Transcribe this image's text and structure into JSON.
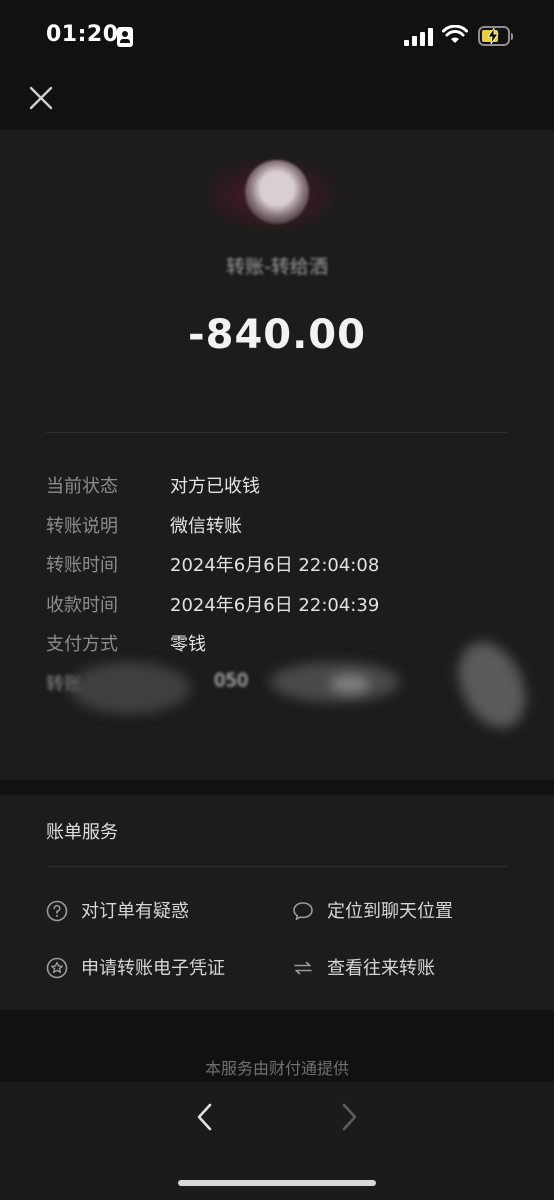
{
  "status": {
    "time": "01:20",
    "battery_color": "#e9cf33"
  },
  "header": {
    "close_icon": "close-icon"
  },
  "transfer": {
    "payee_text": "转账-转给洒",
    "amount": "-840.00"
  },
  "details": [
    {
      "label": "当前状态",
      "value": "对方已收钱"
    },
    {
      "label": "转账说明",
      "value": "微信转账"
    },
    {
      "label": "转账时间",
      "value": "2024年6月6日 22:04:08"
    },
    {
      "label": "收款时间",
      "value": "2024年6月6日 22:04:39"
    },
    {
      "label": "支付方式",
      "value": "零钱"
    },
    {
      "label": "转账",
      "value": "050"
    }
  ],
  "bill_service": {
    "title": "账单服务",
    "actions": [
      {
        "label": "对订单有疑惑",
        "icon": "question-circle-icon"
      },
      {
        "label": "定位到聊天位置",
        "icon": "chat-bubble-icon"
      },
      {
        "label": "申请转账电子凭证",
        "icon": "star-badge-icon"
      },
      {
        "label": "查看往来转账",
        "icon": "swap-arrows-icon"
      }
    ]
  },
  "footer": {
    "text": "本服务由财付通提供"
  }
}
